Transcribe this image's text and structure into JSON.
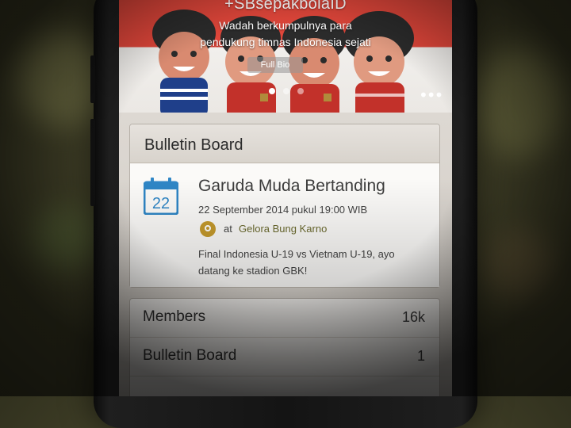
{
  "profile": {
    "handle": "+SBsepakbolaID",
    "tagline_line1": "Wadah berkumpulnya para",
    "tagline_line2": "pendukung timnas Indonesia sejati",
    "full_bio_label": "Full Bio",
    "carousel": {
      "count": 3,
      "active_index": 0
    },
    "more_icon": "more-dots-icon"
  },
  "bulletin_board": {
    "title": "Bulletin Board",
    "event": {
      "calendar_icon": "calendar-icon",
      "calendar_day": "22",
      "title": "Garuda Muda Bertanding",
      "datetime": "22 September 2014 pukul 19:00 WIB",
      "location_icon": "map-pin-icon",
      "at_label": "at",
      "venue": "Gelora Bung Karno",
      "description": "Final Indonesia U-19 vs Vietnam U-19, ayo datang ke stadion GBK!"
    }
  },
  "stats": [
    {
      "label": "Members",
      "value": "16k"
    },
    {
      "label": "Bulletin Board",
      "value": "1"
    }
  ],
  "colors": {
    "hero_red": "#e0463a",
    "jersey_red": "#c2312a",
    "venue_text": "#6b6a2e",
    "pin_gold": "#c59a2c",
    "calendar_blue": "#2f86c6"
  }
}
